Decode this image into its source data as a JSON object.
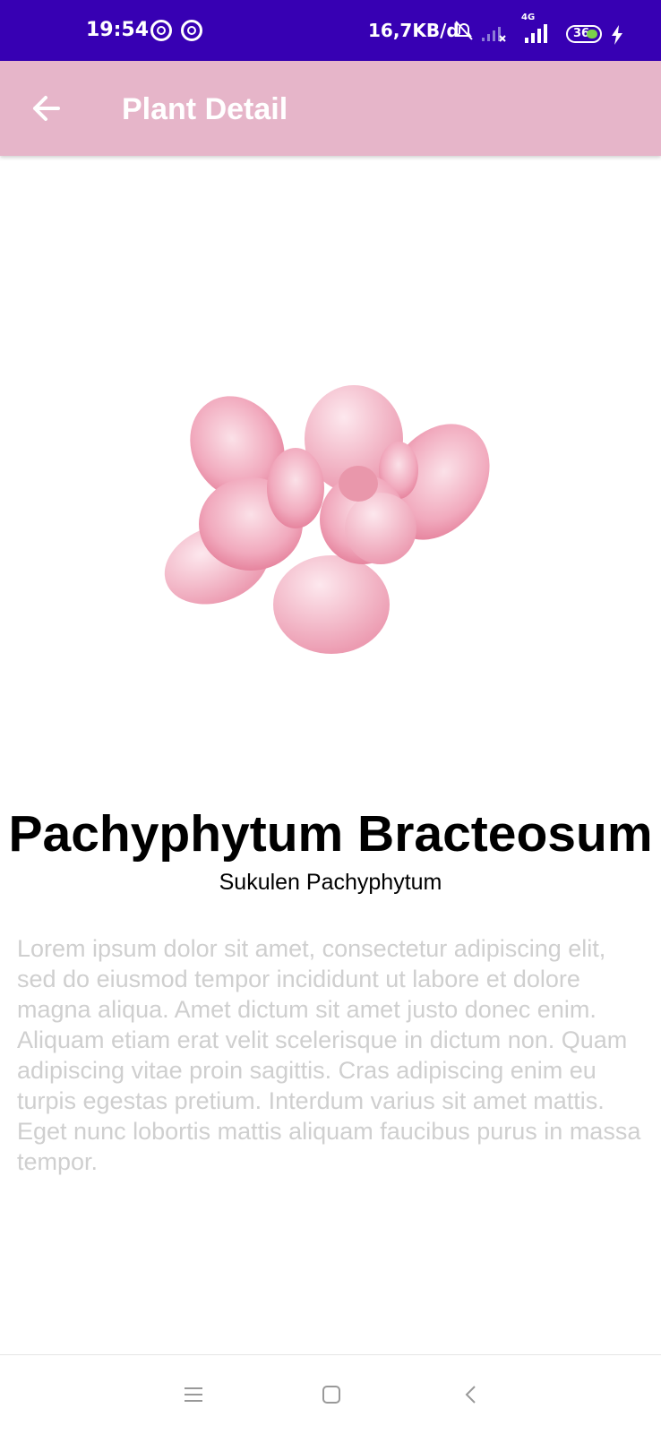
{
  "status_bar": {
    "time": "19:54",
    "network_speed": "16,7KB/d",
    "network_type": "4G",
    "battery": "36",
    "icons": [
      "sync-icon",
      "sync-icon",
      "bell-off-icon",
      "signal-icon",
      "signal-icon",
      "battery-icon",
      "charging-icon"
    ]
  },
  "app_bar": {
    "title": "Plant Detail",
    "back_icon": "arrow-left-icon",
    "background": "#e6b5c9"
  },
  "plant": {
    "name": "Pachyphytum Bracteosum",
    "category": "Sukulen Pachyphytum",
    "description": "Lorem ipsum dolor sit amet, consectetur adipiscing elit, sed do eiusmod tempor incididunt ut labore et dolore magna aliqua. Amet dictum sit amet justo donec enim. Aliquam etiam erat velit scelerisque in dictum non. Quam adipiscing vitae proin sagittis. Cras adipiscing enim eu turpis egestas pretium. Interdum varius sit amet mattis. Eget nunc lobortis mattis aliquam faucibus purus in massa tempor.",
    "image_icon": "succulent-illustration"
  },
  "nav_bar": {
    "icons": [
      "menu-icon",
      "home-icon",
      "back-icon"
    ]
  },
  "colors": {
    "status_bar": "#3700b3",
    "app_bar": "#e6b5c9",
    "description_text": "#cfcfcf"
  }
}
